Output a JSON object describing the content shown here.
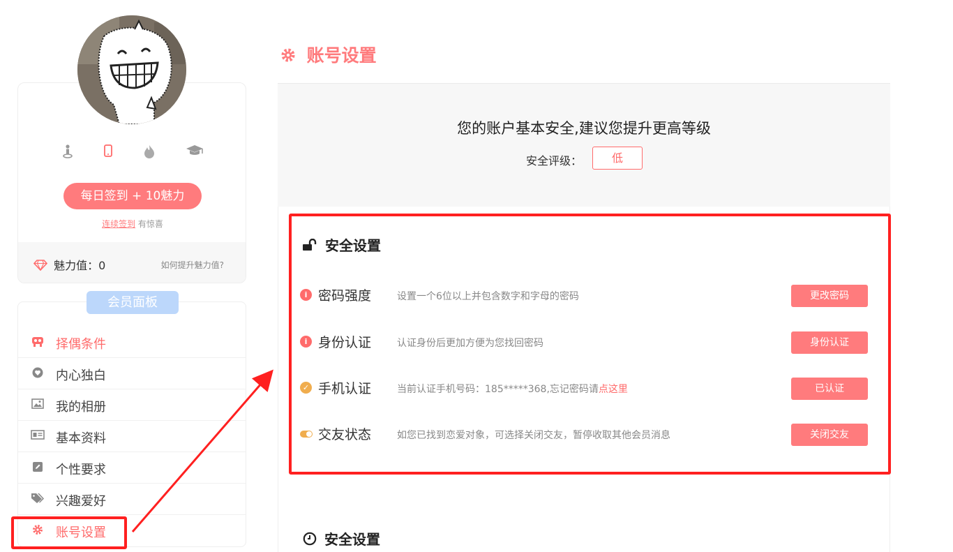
{
  "title": "账号设置",
  "profile": {
    "checkin_button": "每日签到 + 10魅力",
    "checkin_link": "连续签到",
    "checkin_suffix": "有惊喜",
    "charm_label": "魅力值：0",
    "charm_help": "如何提升魅力值?",
    "status_icons": [
      "id-verify-icon",
      "mobile-icon",
      "fire-icon",
      "education-icon"
    ]
  },
  "member_panel": {
    "title": "会员面板",
    "items": [
      {
        "label": "择偶条件",
        "icon": "partner-icon",
        "active": true
      },
      {
        "label": "内心独白",
        "icon": "heart-icon",
        "active": false
      },
      {
        "label": "我的相册",
        "icon": "photo-icon",
        "active": false
      },
      {
        "label": "基本资料",
        "icon": "id-card-icon",
        "active": false
      },
      {
        "label": "个性要求",
        "icon": "edit-icon",
        "active": false
      },
      {
        "label": "兴趣爱好",
        "icon": "tags-icon",
        "active": false
      },
      {
        "label": "账号设置",
        "icon": "gear-icon",
        "active": true
      }
    ]
  },
  "summary": {
    "message": "您的账户基本安全,建议您提升更高等级",
    "rating_label": "安全评级：",
    "rating_value": "低"
  },
  "security": {
    "title": "安全设置",
    "rows": [
      {
        "name": "密码强度",
        "desc": "设置一个6位以上并包含数字和字母的密码",
        "button": "更改密码",
        "status": "warning"
      },
      {
        "name": "身份认证",
        "desc": "认证身份后更加方便为您找回密码",
        "button": "身份认证",
        "status": "warning"
      },
      {
        "name": "手机认证",
        "desc": "当前认证手机号码：185*****368,忘记密码请",
        "link": "点这里",
        "button": "已认证",
        "status": "ok"
      },
      {
        "name": "交友状态",
        "desc": "如您已找到恋爱对象，可选择关闭交友，暂停收取其他会员消息",
        "button": "关闭交友",
        "status": "toggle-on"
      }
    ]
  },
  "security2": {
    "title": "安全设置"
  },
  "colors": {
    "accent": "#ff7b7d",
    "panel_tag": "#bcd7fb",
    "highlight": "#ff2020"
  }
}
